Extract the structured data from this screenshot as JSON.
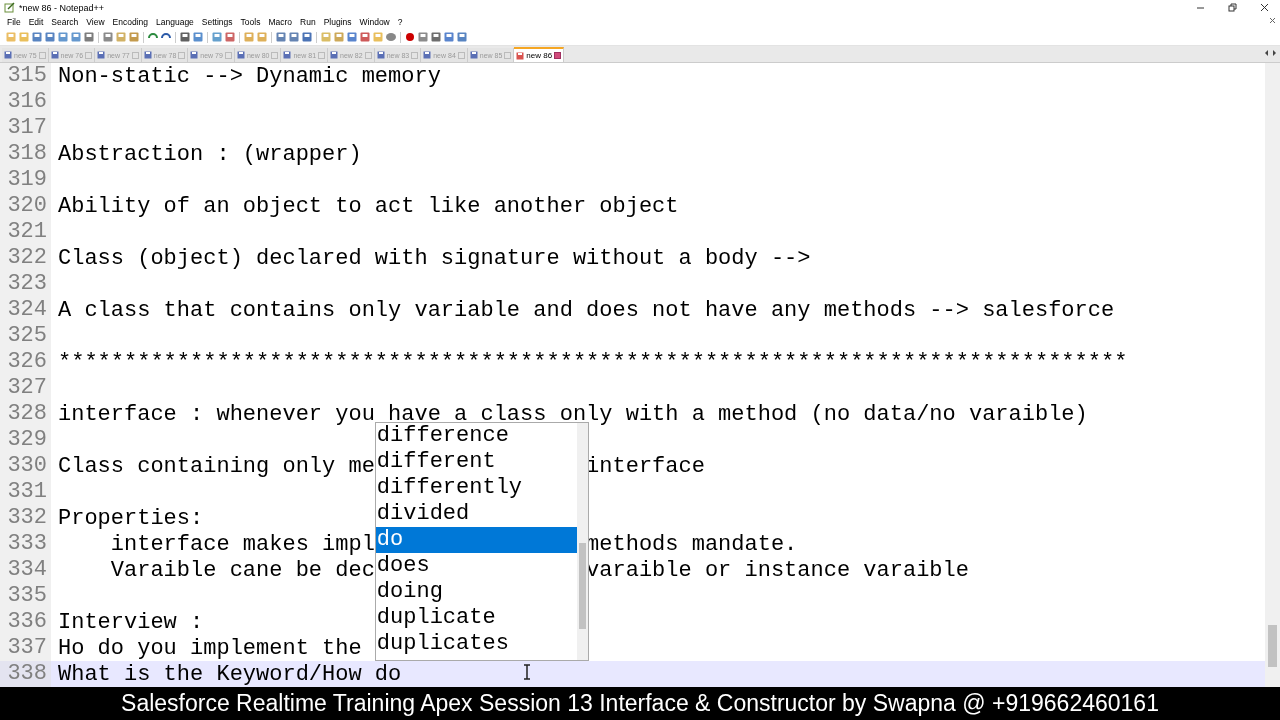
{
  "window": {
    "title": "*new 86 - Notepad++"
  },
  "menu": [
    "File",
    "Edit",
    "Search",
    "View",
    "Encoding",
    "Language",
    "Settings",
    "Tools",
    "Macro",
    "Run",
    "Plugins",
    "Window",
    "?"
  ],
  "tabs": [
    {
      "label": "new 75",
      "selected": false
    },
    {
      "label": "new 76",
      "selected": false
    },
    {
      "label": "new 77",
      "selected": false
    },
    {
      "label": "new 78",
      "selected": false
    },
    {
      "label": "new 79",
      "selected": false
    },
    {
      "label": "new 80",
      "selected": false
    },
    {
      "label": "new 81",
      "selected": false
    },
    {
      "label": "new 82",
      "selected": false
    },
    {
      "label": "new 83",
      "selected": false
    },
    {
      "label": "new 84",
      "selected": false
    },
    {
      "label": "new 85",
      "selected": false
    },
    {
      "label": "new 86",
      "selected": true
    }
  ],
  "editor": {
    "lines": [
      {
        "number": "315",
        "text": "Non-static --> Dynamic memory",
        "current": false
      },
      {
        "number": "316",
        "current": false
      },
      {
        "number": "317",
        "current": false
      },
      {
        "number": "318",
        "text": "Abstraction : (wrapper)",
        "current": false
      },
      {
        "number": "319",
        "current": false
      },
      {
        "number": "320",
        "text": "Ability of an object to act like another object",
        "current": false
      },
      {
        "number": "321",
        "current": false
      },
      {
        "number": "322",
        "text": "Class (object) declared with signature without a body -->",
        "current": false
      },
      {
        "number": "323",
        "current": false
      },
      {
        "number": "324",
        "text": "A class that contains only variable and does not have any methods --> salesforce",
        "current": false
      },
      {
        "number": "325",
        "current": false
      },
      {
        "number": "326",
        "text": "*********************************************************************************",
        "current": false
      },
      {
        "number": "327",
        "current": false
      },
      {
        "number": "328",
        "text": "interface : whenever you have a class only with a method (no data/no varaible)",
        "current": false
      },
      {
        "number": "329",
        "current": false
      },
      {
        "number": "330",
        "text": "Class containing only me",
        "text_right": "interface",
        "current": false
      },
      {
        "number": "331",
        "current": false
      },
      {
        "number": "332",
        "text": "Properties:",
        "current": false
      },
      {
        "number": "333",
        "text": "    interface makes impl",
        "text_right": "methods mandate.",
        "current": false
      },
      {
        "number": "334",
        "text": "    Varaible cane be dec",
        "text_right": "varaible or instance varaible",
        "current": false
      },
      {
        "number": "335",
        "current": false
      },
      {
        "number": "336",
        "text": "Interview :",
        "current": false
      },
      {
        "number": "337",
        "text": "Ho do you implement the",
        "current": false
      },
      {
        "number": "338",
        "text": "What is the Keyword/How do",
        "current": true
      }
    ]
  },
  "autocomplete": [
    {
      "label": "difference",
      "selected": false
    },
    {
      "label": "different",
      "selected": false
    },
    {
      "label": "differently",
      "selected": false
    },
    {
      "label": "divided",
      "selected": false
    },
    {
      "label": "do",
      "selected": true
    },
    {
      "label": "does",
      "selected": false
    },
    {
      "label": "doing",
      "selected": false
    },
    {
      "label": "duplicate",
      "selected": false
    },
    {
      "label": "duplicates",
      "selected": false
    }
  ],
  "caption": "Salesforce Realtime Training Apex Session 13 Interface & Constructor by Swapna @ +919662460161"
}
